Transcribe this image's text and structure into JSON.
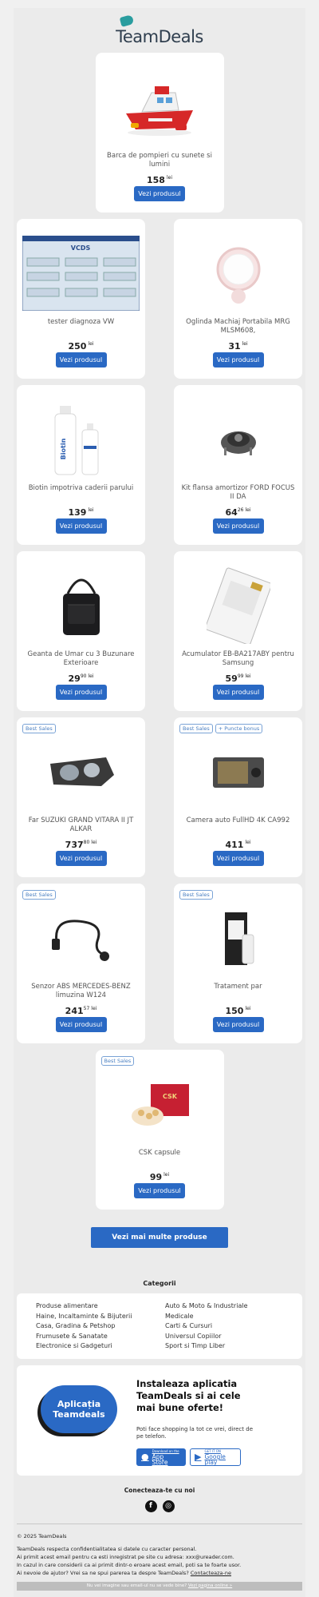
{
  "brand": {
    "logo_text_a": "Team",
    "logo_text_b": "Deals",
    "accent": "#2a69c4",
    "tag_color": "#2a9d9f"
  },
  "products": [
    {
      "name": "Barca de pompieri cu sunete si lumini",
      "price": "158",
      "cents": "",
      "currency": "lei",
      "cta": "Vezi produsul",
      "badges": [],
      "icon": "fire-boat-toy"
    },
    {
      "name": "tester diagnoza VW",
      "price": "250",
      "cents": "",
      "currency": "lei",
      "cta": "Vezi produsul",
      "badges": [],
      "icon": "vcds-screenshot",
      "vcds_title": "VCDS"
    },
    {
      "name": "Oglinda Machiaj Portabila MRG MLSM608,",
      "price": "31",
      "cents": "",
      "currency": "lei",
      "cta": "Vezi produsul",
      "badges": [],
      "icon": "compact-mirror"
    },
    {
      "name": "Biotin impotriva caderii parului",
      "price": "139",
      "cents": "",
      "currency": "lei",
      "cta": "Vezi produsul",
      "badges": [],
      "icon": "biotin-bottles",
      "bottle_label": "Biotin"
    },
    {
      "name": "Kit flansa amortizor FORD FOCUS II DA",
      "price": "64",
      "cents": "26",
      "currency": "lei",
      "cta": "Vezi produsul",
      "badges": [],
      "icon": "strut-mount"
    },
    {
      "name": "Geanta de Umar cu 3 Buzunare Exterioare",
      "price": "29",
      "cents": "90",
      "currency": "lei",
      "cta": "Vezi produsul",
      "badges": [],
      "icon": "shoulder-bag"
    },
    {
      "name": "Acumulator EB-BA217ABY pentru Samsung",
      "price": "59",
      "cents": "99",
      "currency": "lei",
      "cta": "Vezi produsul",
      "badges": [],
      "icon": "phone-battery"
    },
    {
      "name": "Far SUZUKI GRAND VITARA II JT ALKAR",
      "price": "737",
      "cents": "80",
      "currency": "lei",
      "cta": "Vezi produsul",
      "badges": [
        "Best Sales"
      ],
      "icon": "headlight"
    },
    {
      "name": "Camera auto FullHD 4K CA992",
      "price": "411",
      "cents": "",
      "currency": "lei",
      "cta": "Vezi produsul",
      "badges": [
        "Best Sales",
        "+ Puncte bonus"
      ],
      "icon": "dash-camera"
    },
    {
      "name": "Senzor ABS MERCEDES-BENZ limuzina W124",
      "price": "241",
      "cents": "57",
      "currency": "lei",
      "cta": "Vezi produsul",
      "badges": [
        "Best Sales"
      ],
      "icon": "abs-sensor"
    },
    {
      "name": "Tratament par",
      "price": "150",
      "cents": "",
      "currency": "lei",
      "cta": "Vezi produsul",
      "badges": [
        "Best Sales"
      ],
      "icon": "hair-treatment-box"
    },
    {
      "name": "CSK capsule",
      "price": "99",
      "cents": "",
      "currency": "lei",
      "cta": "Vezi produsul",
      "badges": [
        "Best Sales"
      ],
      "icon": "csk-capsules",
      "box_label": "CSK"
    }
  ],
  "more_button": "Vezi mai multe produse",
  "categories": {
    "title": "Categorii",
    "items": [
      "Produse alimentare",
      "Auto & Moto & Industriale",
      "Haine, Incaltaminte & Bijuterii",
      "Medicale",
      "Casa, Gradina & Petshop",
      "Carti & Cursuri",
      "Frumusete & Sanatate",
      "Universul Copiilor",
      "Electronice si Gadgeturi",
      "Sport si Timp Liber"
    ]
  },
  "app": {
    "pill_line1": "Aplicația",
    "pill_line2": "Teamdeals",
    "title": "Instaleaza aplicatia TeamDeals si ai cele mai bune oferte!",
    "description": "Poti face shopping la tot ce vrei, direct de pe telefon.",
    "appstore_small": "Download on the",
    "appstore_big": "App Store",
    "gplay_small": "GET IT ON",
    "gplay_big": "Google play"
  },
  "social": {
    "title": "Conecteaza-te cu noi",
    "facebook": "f",
    "instagram": "◎"
  },
  "footer": {
    "copyright": "© 2025 TeamDeals",
    "line1": "TeamDeals respecta confidentialitatea si datele cu caracter personal.",
    "line2": "Ai primit acest email pentru ca esti inregistrat pe site cu adresa: xxx@ureader.com.",
    "line3": "In cazul in care considerii ca ai primit dintr-o eroare acest email, poti sa te foarte usor.",
    "line4": "Ai nevoie de ajutor? Vrei sa ne spui parerea ta despre TeamDeals?",
    "contact_link": "Contacteaza-ne",
    "unsub_text": "Nu vei imagine sau email-ul nu se vede bine? ",
    "unsub_link": "Vezi pagina online »"
  }
}
